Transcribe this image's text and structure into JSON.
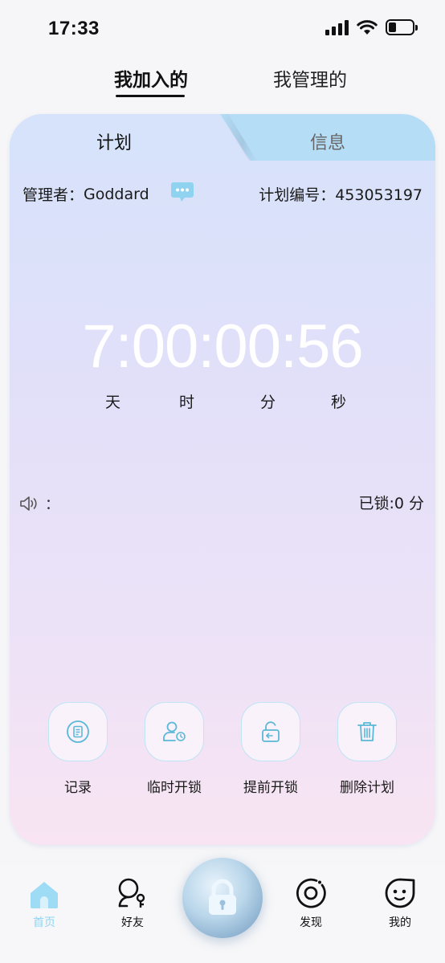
{
  "status_bar": {
    "time": "17:33",
    "icons": [
      "signal-icon",
      "wifi-icon",
      "battery-icon"
    ]
  },
  "top_tabs": {
    "joined": "我加入的",
    "managed": "我管理的"
  },
  "card": {
    "tabs": {
      "plan": "计划",
      "info": "信息"
    },
    "manager_label": "管理者：",
    "manager_name": "Goddard",
    "plan_number_label": "计划编号：",
    "plan_number": "453053197",
    "countdown": "7:00:00:56",
    "units": {
      "day": "天",
      "hour": "时",
      "minute": "分",
      "second": "秒"
    },
    "sound_label": "：",
    "locked_text": "已锁:0 分",
    "actions": [
      {
        "label": "记录",
        "icon": "record-icon"
      },
      {
        "label": "临时开锁",
        "icon": "temp-unlock-icon"
      },
      {
        "label": "提前开锁",
        "icon": "early-unlock-icon"
      },
      {
        "label": "删除计划",
        "icon": "delete-icon"
      }
    ]
  },
  "bottom_nav": {
    "items": [
      {
        "label": "首页",
        "icon": "home-icon",
        "active": true
      },
      {
        "label": "好友",
        "icon": "friends-icon",
        "active": false
      },
      {
        "label": "",
        "icon": "lock-icon",
        "active": false
      },
      {
        "label": "发现",
        "icon": "discover-icon",
        "active": false
      },
      {
        "label": "我的",
        "icon": "profile-icon",
        "active": false
      }
    ]
  },
  "colors": {
    "accent": "#8dd7f3",
    "icon_teal": "#5ab8d8",
    "card_top": "#d6e2fb",
    "card_bottom": "#f8e4f2",
    "info_tab": "#b5ddf5"
  }
}
